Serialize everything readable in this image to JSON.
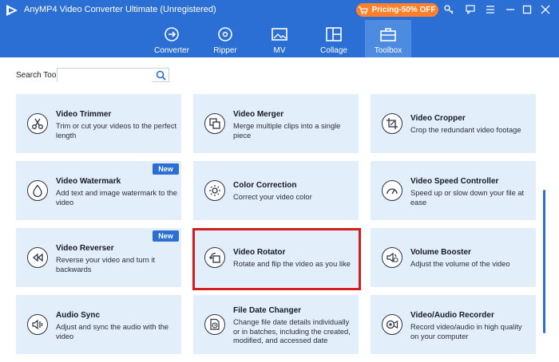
{
  "app": {
    "title": "AnyMP4 Video Converter Ultimate (Unregistered)",
    "pricing_label": "Pricing-50% OFF",
    "accent_color": "#2c6fd4",
    "pricing_color": "#ff7f2a"
  },
  "nav": {
    "tabs": [
      {
        "label": "Converter",
        "icon": "converter-icon"
      },
      {
        "label": "Ripper",
        "icon": "disc-icon"
      },
      {
        "label": "MV",
        "icon": "mv-image-icon"
      },
      {
        "label": "Collage",
        "icon": "collage-icon"
      },
      {
        "label": "Toolbox",
        "icon": "toolbox-icon",
        "active": true
      }
    ]
  },
  "search": {
    "label": "Search Tool:",
    "value": "",
    "placeholder": ""
  },
  "tools": [
    {
      "title": "Video Trimmer",
      "desc": "Trim or cut your videos to the perfect length",
      "icon": "scissors-icon"
    },
    {
      "title": "Video Merger",
      "desc": "Merge multiple clips into a single piece",
      "icon": "merge-icon"
    },
    {
      "title": "Video Cropper",
      "desc": "Crop the redundant video footage",
      "icon": "crop-icon"
    },
    {
      "title": "Video Watermark",
      "desc": "Add text and image watermark to the video",
      "icon": "drop-icon",
      "badge": "New"
    },
    {
      "title": "Color Correction",
      "desc": "Correct your video color",
      "icon": "sun-icon"
    },
    {
      "title": "Video Speed Controller",
      "desc": "Speed up or slow down your file at ease",
      "icon": "speedometer-icon"
    },
    {
      "title": "Video Reverser",
      "desc": "Reverse your video and turn it backwards",
      "icon": "rewind-icon",
      "badge": "New"
    },
    {
      "title": "Video Rotator",
      "desc": "Rotate and flip the video as you like",
      "icon": "rotate-icon",
      "highlighted": true
    },
    {
      "title": "Volume Booster",
      "desc": "Adjust the volume of the video",
      "icon": "volume-icon"
    },
    {
      "title": "Audio Sync",
      "desc": "Adjust and sync the audio with the video",
      "icon": "audio-sync-icon"
    },
    {
      "title": "File Date Changer",
      "desc": "Change file date details individually or in batches, including the created, modified, and accessed date",
      "icon": "clock-file-icon"
    },
    {
      "title": "Video/Audio Recorder",
      "desc": "Record video/audio in high quality on your computer",
      "icon": "recorder-icon"
    }
  ]
}
